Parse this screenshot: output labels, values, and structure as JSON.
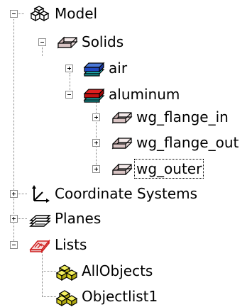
{
  "tree": {
    "model": {
      "label": "Model",
      "expanded": true
    },
    "solids": {
      "label": "Solids",
      "expanded": true
    },
    "air": {
      "label": "air",
      "expanded": false
    },
    "aluminum": {
      "label": "aluminum",
      "expanded": true
    },
    "wg_flange_in": {
      "label": "wg_flange_in",
      "expanded": false
    },
    "wg_flange_out": {
      "label": "wg_flange_out",
      "expanded": false
    },
    "wg_outer": {
      "label": "wg_outer",
      "expanded": false,
      "selected": true
    },
    "coordinate_systems": {
      "label": "Coordinate Systems",
      "expanded": false
    },
    "planes": {
      "label": "Planes",
      "expanded": false
    },
    "lists": {
      "label": "Lists",
      "expanded": true
    },
    "allobjects": {
      "label": "AllObjects"
    },
    "objectlist1": {
      "label": "Objectlist1"
    }
  },
  "icons": {
    "model": "model-cubes-icon",
    "solids": "solid-block-icon",
    "material": "material-layers-icon",
    "object": "solid-object-icon",
    "coordinate_systems": "coordinate-axes-icon",
    "planes": "planes-icon",
    "lists": "lists-icon",
    "list_item": "list-objects-icon"
  },
  "colors": {
    "air_top": "#4a78d8",
    "aluminum_top": "#e02020",
    "object_fill": "#c9b2b2",
    "list_item_fill": "#e8e020"
  }
}
